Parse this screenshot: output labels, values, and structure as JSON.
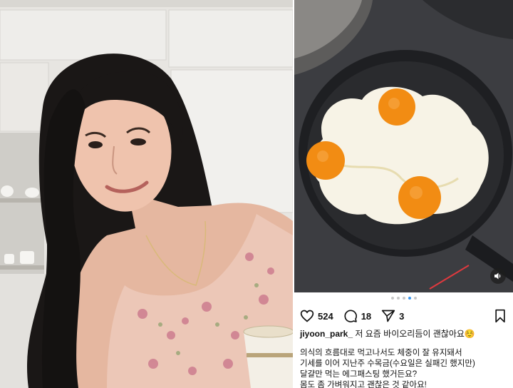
{
  "post": {
    "likes": "524",
    "comments": "18",
    "shares": "3",
    "username": "jiyoon_park_",
    "caption": "저 요즘 바이오리듬이 괜찮아요☺️",
    "body": [
      "의식의 흐름대로 먹고나서도 체중이 잘 유지돼서",
      "기세를 이어 지난주 수목금(수요일은 실패긴 했지만)",
      "달걀만 먹는 에그패스팅 했거든요?",
      "몸도 좀 가벼워지고 괜찮은 것 같아요!"
    ],
    "carousel": {
      "count": 5,
      "active_index": 3
    }
  },
  "icons": {
    "like": "heart-icon",
    "comment": "comment-icon",
    "share": "send-icon",
    "save": "bookmark-icon",
    "mute": "speaker-icon"
  },
  "colors": {
    "accent": "#3897f0",
    "text": "#111111",
    "yolk": "#f28c13"
  }
}
